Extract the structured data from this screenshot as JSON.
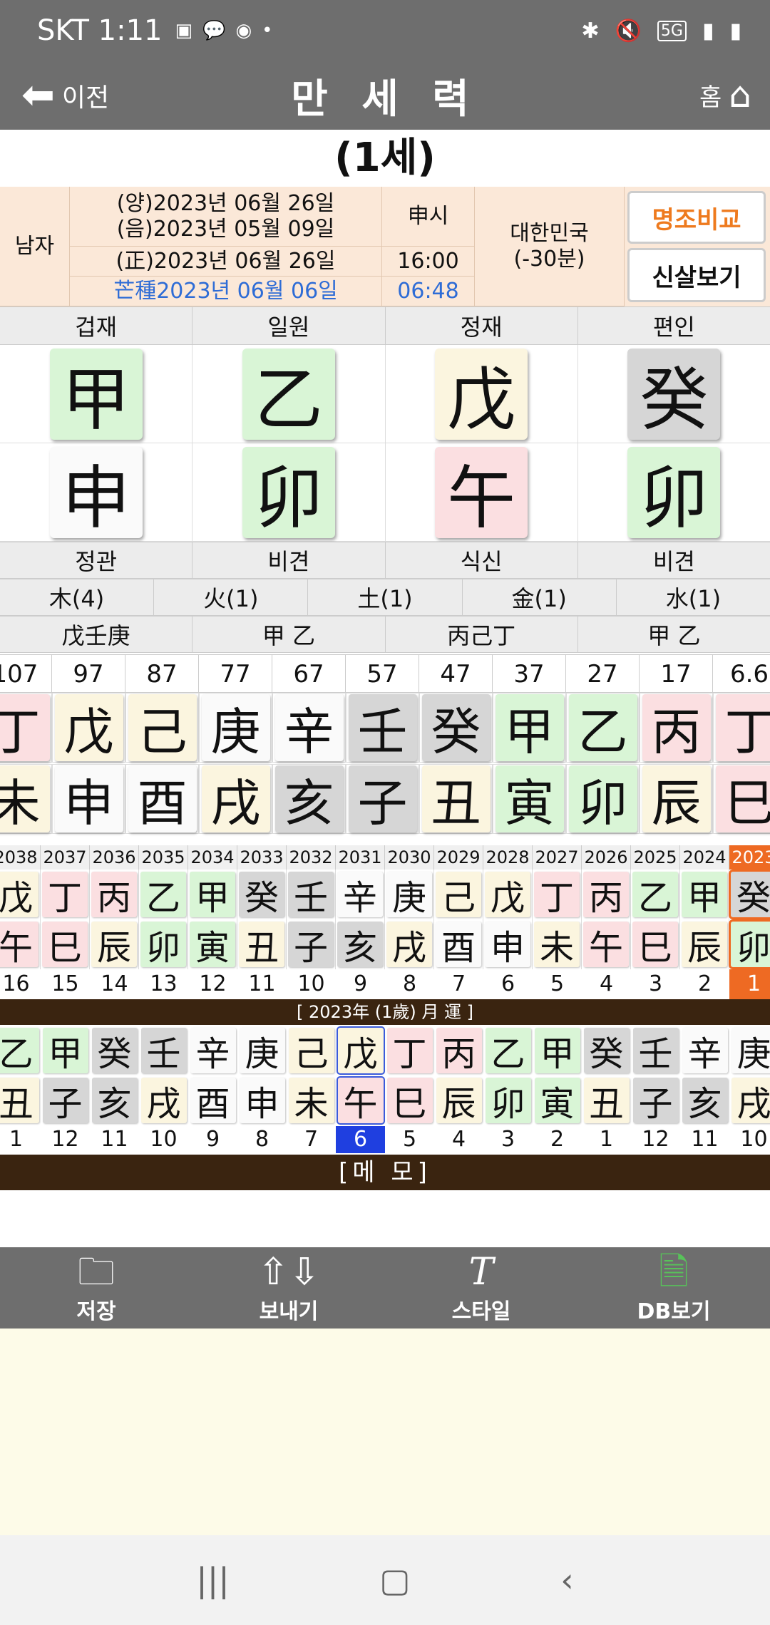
{
  "status": {
    "carrier_time": "SKT 1:11",
    "net": "5G"
  },
  "title": {
    "back": "이전",
    "title": "만 세 력",
    "home": "홈"
  },
  "age": "(1세)",
  "info": {
    "gender": "남자",
    "solar": "(양)2023년 06월 26일",
    "lunar": "(음)2023년 05월 09일",
    "shi": "申시",
    "corrected": "(正)2023년 06월 26일",
    "corrected_time": "16:00",
    "term": "芒種2023년 06월 06일",
    "term_time": "06:48",
    "country": "대한민국",
    "offset": "(-30분)",
    "btn_compare": "명조비교",
    "btn_sinsal": "신살보기"
  },
  "top_labels": [
    "겁재",
    "일원",
    "정재",
    "편인"
  ],
  "stems": [
    {
      "ch": "甲",
      "c": "g"
    },
    {
      "ch": "乙",
      "c": "g"
    },
    {
      "ch": "戊",
      "c": "y"
    },
    {
      "ch": "癸",
      "c": "s"
    }
  ],
  "branches": [
    {
      "ch": "申",
      "c": "w"
    },
    {
      "ch": "卯",
      "c": "g"
    },
    {
      "ch": "午",
      "c": "p"
    },
    {
      "ch": "卯",
      "c": "g"
    }
  ],
  "bottom_labels": [
    "정관",
    "비견",
    "식신",
    "비견"
  ],
  "elements": [
    "木(4)",
    "火(1)",
    "土(1)",
    "金(1)",
    "水(1)"
  ],
  "hidden": [
    "戊壬庚",
    "甲 乙",
    "丙己丁",
    "甲 乙"
  ],
  "daeun": {
    "nums": [
      "107",
      "97",
      "87",
      "77",
      "67",
      "57",
      "47",
      "37",
      "27",
      "17",
      "6.6"
    ],
    "stems": [
      {
        "ch": "丁",
        "c": "p"
      },
      {
        "ch": "戊",
        "c": "y"
      },
      {
        "ch": "己",
        "c": "y"
      },
      {
        "ch": "庚",
        "c": "w"
      },
      {
        "ch": "辛",
        "c": "w"
      },
      {
        "ch": "壬",
        "c": "s"
      },
      {
        "ch": "癸",
        "c": "s"
      },
      {
        "ch": "甲",
        "c": "g"
      },
      {
        "ch": "乙",
        "c": "g"
      },
      {
        "ch": "丙",
        "c": "p"
      },
      {
        "ch": "丁",
        "c": "p"
      }
    ],
    "branches": [
      {
        "ch": "未",
        "c": "y"
      },
      {
        "ch": "申",
        "c": "w"
      },
      {
        "ch": "酉",
        "c": "w"
      },
      {
        "ch": "戌",
        "c": "y"
      },
      {
        "ch": "亥",
        "c": "s"
      },
      {
        "ch": "子",
        "c": "s"
      },
      {
        "ch": "丑",
        "c": "y"
      },
      {
        "ch": "寅",
        "c": "g"
      },
      {
        "ch": "卯",
        "c": "g"
      },
      {
        "ch": "辰",
        "c": "y"
      },
      {
        "ch": "巳",
        "c": "p"
      }
    ]
  },
  "seun": {
    "years": [
      "2038",
      "2037",
      "2036",
      "2035",
      "2034",
      "2033",
      "2032",
      "2031",
      "2030",
      "2029",
      "2028",
      "2027",
      "2026",
      "2025",
      "2024",
      "2023"
    ],
    "stems": [
      {
        "ch": "戊",
        "c": "y"
      },
      {
        "ch": "丁",
        "c": "p"
      },
      {
        "ch": "丙",
        "c": "p"
      },
      {
        "ch": "乙",
        "c": "g"
      },
      {
        "ch": "甲",
        "c": "g"
      },
      {
        "ch": "癸",
        "c": "s"
      },
      {
        "ch": "壬",
        "c": "s"
      },
      {
        "ch": "辛",
        "c": "w"
      },
      {
        "ch": "庚",
        "c": "w"
      },
      {
        "ch": "己",
        "c": "y"
      },
      {
        "ch": "戊",
        "c": "y"
      },
      {
        "ch": "丁",
        "c": "p"
      },
      {
        "ch": "丙",
        "c": "p"
      },
      {
        "ch": "乙",
        "c": "g"
      },
      {
        "ch": "甲",
        "c": "g"
      },
      {
        "ch": "癸",
        "c": "s"
      }
    ],
    "branches": [
      {
        "ch": "午",
        "c": "p"
      },
      {
        "ch": "巳",
        "c": "p"
      },
      {
        "ch": "辰",
        "c": "y"
      },
      {
        "ch": "卯",
        "c": "g"
      },
      {
        "ch": "寅",
        "c": "g"
      },
      {
        "ch": "丑",
        "c": "y"
      },
      {
        "ch": "子",
        "c": "s"
      },
      {
        "ch": "亥",
        "c": "s"
      },
      {
        "ch": "戌",
        "c": "y"
      },
      {
        "ch": "酉",
        "c": "w"
      },
      {
        "ch": "申",
        "c": "w"
      },
      {
        "ch": "未",
        "c": "y"
      },
      {
        "ch": "午",
        "c": "p"
      },
      {
        "ch": "巳",
        "c": "p"
      },
      {
        "ch": "辰",
        "c": "y"
      },
      {
        "ch": "卯",
        "c": "g"
      }
    ],
    "ages": [
      "16",
      "15",
      "14",
      "13",
      "12",
      "11",
      "10",
      "9",
      "8",
      "7",
      "6",
      "5",
      "4",
      "3",
      "2",
      "1"
    ]
  },
  "wolun": {
    "header": "[ 2023年 (1歲) 月 運 ]",
    "stems": [
      {
        "ch": "乙",
        "c": "g"
      },
      {
        "ch": "甲",
        "c": "g"
      },
      {
        "ch": "癸",
        "c": "s"
      },
      {
        "ch": "壬",
        "c": "s"
      },
      {
        "ch": "辛",
        "c": "w"
      },
      {
        "ch": "庚",
        "c": "w"
      },
      {
        "ch": "己",
        "c": "y"
      },
      {
        "ch": "戊",
        "c": "y"
      },
      {
        "ch": "丁",
        "c": "p"
      },
      {
        "ch": "丙",
        "c": "p"
      },
      {
        "ch": "乙",
        "c": "g"
      },
      {
        "ch": "甲",
        "c": "g"
      },
      {
        "ch": "癸",
        "c": "s"
      },
      {
        "ch": "壬",
        "c": "s"
      },
      {
        "ch": "辛",
        "c": "w"
      },
      {
        "ch": "庚",
        "c": "w"
      }
    ],
    "branches": [
      {
        "ch": "丑",
        "c": "y"
      },
      {
        "ch": "子",
        "c": "s"
      },
      {
        "ch": "亥",
        "c": "s"
      },
      {
        "ch": "戌",
        "c": "y"
      },
      {
        "ch": "酉",
        "c": "w"
      },
      {
        "ch": "申",
        "c": "w"
      },
      {
        "ch": "未",
        "c": "y"
      },
      {
        "ch": "午",
        "c": "p"
      },
      {
        "ch": "巳",
        "c": "p"
      },
      {
        "ch": "辰",
        "c": "y"
      },
      {
        "ch": "卯",
        "c": "g"
      },
      {
        "ch": "寅",
        "c": "g"
      },
      {
        "ch": "丑",
        "c": "y"
      },
      {
        "ch": "子",
        "c": "s"
      },
      {
        "ch": "亥",
        "c": "s"
      },
      {
        "ch": "戌",
        "c": "y"
      }
    ],
    "months": [
      "1",
      "12",
      "11",
      "10",
      "9",
      "8",
      "7",
      "6",
      "5",
      "4",
      "3",
      "2",
      "1",
      "12",
      "11",
      "10"
    ],
    "selected_index": 7
  },
  "memo": "[메 모]",
  "toolbar": [
    "저장",
    "보내기",
    "스타일",
    "DB보기"
  ]
}
